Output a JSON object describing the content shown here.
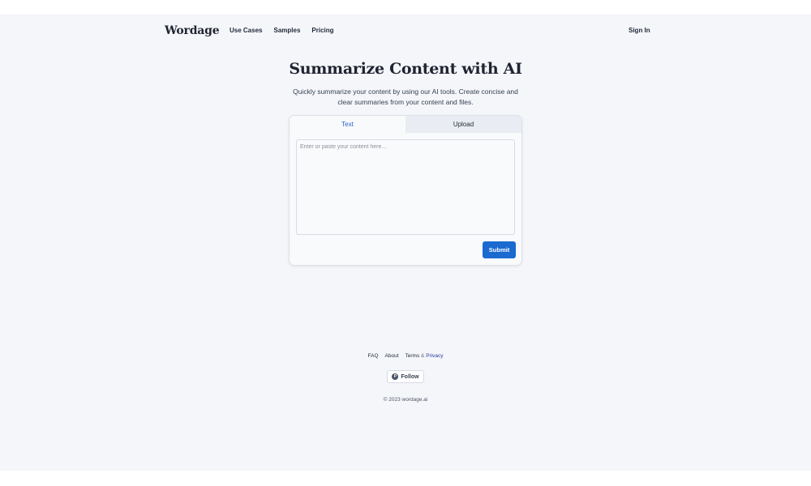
{
  "header": {
    "logo": "Wordage",
    "nav": [
      "Use Cases",
      "Samples",
      "Pricing"
    ],
    "sign_in": "Sign In"
  },
  "hero": {
    "title": "Summarize Content with AI",
    "subtitle": "Quickly summarize your content by using our AI tools. Create concise and clear summaries from your content and files."
  },
  "editor": {
    "tabs": [
      {
        "label": "Text",
        "active": true
      },
      {
        "label": "Upload",
        "active": false
      }
    ],
    "placeholder": "Enter or paste your content here...",
    "value": "",
    "submit_label": "Submit"
  },
  "footer": {
    "faq": "FAQ",
    "about": "About",
    "terms": "Terms",
    "amp": "&",
    "privacy": "Privacy",
    "follow_icon": "P",
    "follow_label": "Follow",
    "copyright": "© 2023 wordage.ai"
  },
  "colors": {
    "accent": "#1a6ad0",
    "active_tab_text": "#2563c9",
    "background": "#f5f6fa"
  }
}
